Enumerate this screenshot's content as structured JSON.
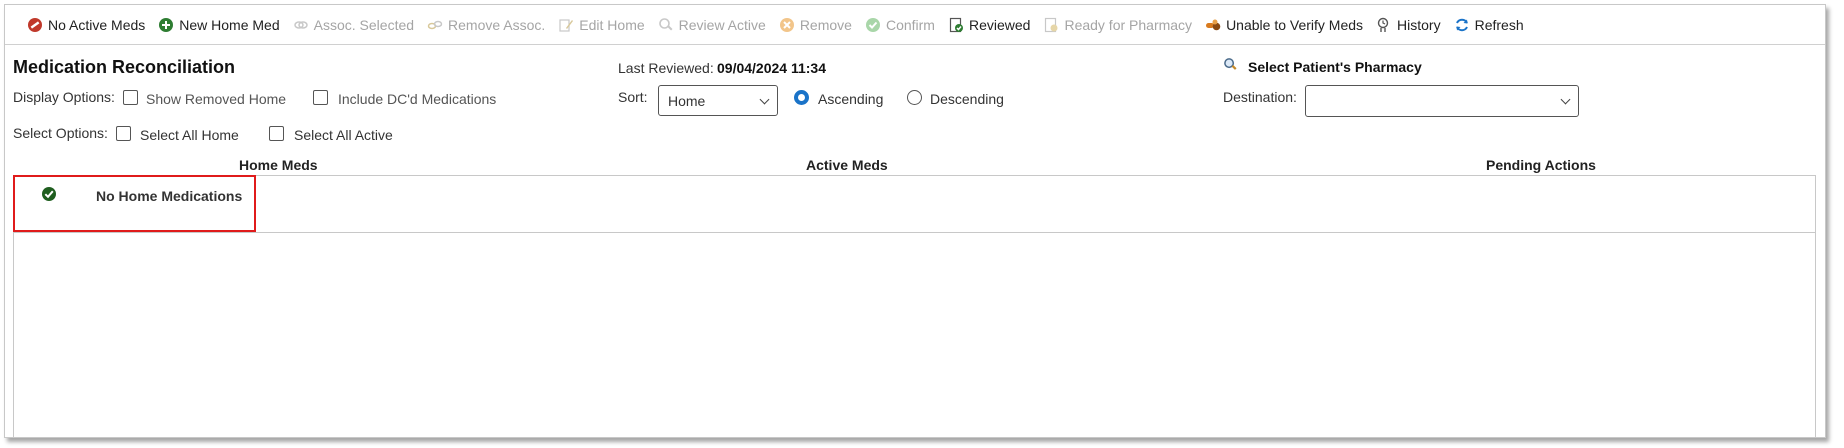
{
  "toolbar": {
    "items": [
      {
        "label": "No Active Meds",
        "icon": "no-entry-icon",
        "disabled": false
      },
      {
        "label": "New Home Med",
        "icon": "add-circle-icon",
        "disabled": false
      },
      {
        "label": "Assoc. Selected",
        "icon": "link-icon",
        "disabled": true
      },
      {
        "label": "Remove Assoc.",
        "icon": "unlink-icon",
        "disabled": true
      },
      {
        "label": "Edit Home",
        "icon": "edit-pencil-icon",
        "disabled": true
      },
      {
        "label": "Review Active",
        "icon": "magnifier-icon",
        "disabled": true
      },
      {
        "label": "Remove",
        "icon": "remove-icon",
        "disabled": true
      },
      {
        "label": "Confirm",
        "icon": "check-circle-icon",
        "disabled": true
      },
      {
        "label": "Reviewed",
        "icon": "document-check-icon",
        "disabled": false
      },
      {
        "label": "Ready for Pharmacy",
        "icon": "document-icon",
        "disabled": true
      },
      {
        "label": "Unable to Verify Meds",
        "icon": "pills-icon",
        "disabled": false
      },
      {
        "label": "History",
        "icon": "history-icon",
        "disabled": false
      },
      {
        "label": "Refresh",
        "icon": "refresh-icon",
        "disabled": false
      }
    ]
  },
  "header": {
    "title": "Medication Reconciliation",
    "display_options_label": "Display Options:",
    "show_removed_home": "Show Removed Home",
    "include_dcd": "Include DC'd Medications",
    "select_options_label": "Select Options:",
    "select_all_home": "Select All Home",
    "select_all_active": "Select All Active",
    "last_reviewed_label": "Last Reviewed:",
    "last_reviewed_value": "09/04/2024 11:34",
    "sort_label": "Sort:",
    "sort_value": "Home",
    "ascending": "Ascending",
    "descending": "Descending",
    "pharmacy_link": "Select Patient's Pharmacy",
    "destination_label": "Destination:",
    "destination_value": ""
  },
  "columns": {
    "home": "Home Meds",
    "active": "Active Meds",
    "pending": "Pending Actions"
  },
  "grid": {
    "home_status": "No Home Medications"
  },
  "colors": {
    "accent": "#1a73c8",
    "highlight": "#e01b1b",
    "disabled_text": "#a5a5a5"
  }
}
